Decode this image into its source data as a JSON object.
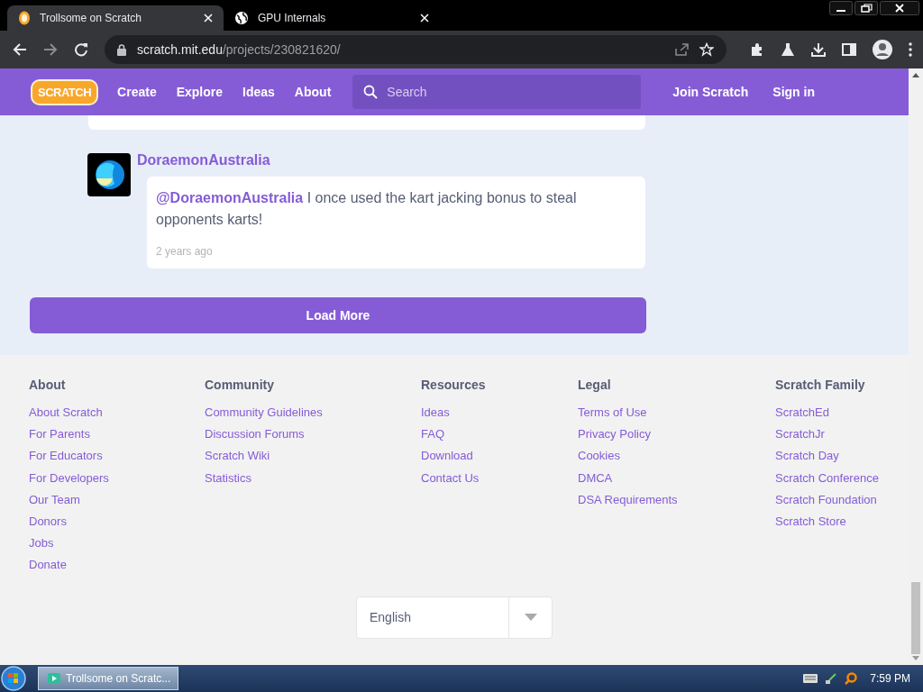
{
  "browser": {
    "tabs": [
      {
        "title": "Trollsome on Scratch",
        "kind": "scratch",
        "selected": true
      },
      {
        "title": "GPU Internals",
        "kind": "globe",
        "selected": false
      }
    ],
    "url_host": "scratch.mit.edu",
    "url_path": "/projects/230821620/"
  },
  "navbar": {
    "logo": "SCRATCH",
    "links": [
      "Create",
      "Explore",
      "Ideas",
      "About"
    ],
    "search": {
      "placeholder": "Search"
    },
    "actions": [
      "Join Scratch",
      "Sign in"
    ]
  },
  "comment": {
    "author": "DoraemonAustralia",
    "mention": "@DoraemonAustralia",
    "text": "I once used the kart jacking bonus to steal opponents karts!",
    "time": "2 years ago"
  },
  "load_more": "Load More",
  "footer": {
    "columns": [
      {
        "heading": "About",
        "links": [
          "About Scratch",
          "For Parents",
          "For Educators",
          "For Developers",
          "Our Team",
          "Donors",
          "Jobs",
          "Donate"
        ]
      },
      {
        "heading": "Community",
        "links": [
          "Community Guidelines",
          "Discussion Forums",
          "Scratch Wiki",
          "Statistics"
        ]
      },
      {
        "heading": "Resources",
        "links": [
          "Ideas",
          "FAQ",
          "Download",
          "Contact Us"
        ]
      },
      {
        "heading": "Legal",
        "links": [
          "Terms of Use",
          "Privacy Policy",
          "Cookies",
          "DMCA",
          "DSA Requirements"
        ]
      },
      {
        "heading": "Scratch Family",
        "links": [
          "ScratchEd",
          "ScratchJr",
          "Scratch Day",
          "Scratch Conference",
          "Scratch Foundation",
          "Scratch Store"
        ]
      }
    ],
    "language": "English"
  },
  "taskbar": {
    "window": "Trollsome on Scratc...",
    "clock": "7:59 PM"
  }
}
